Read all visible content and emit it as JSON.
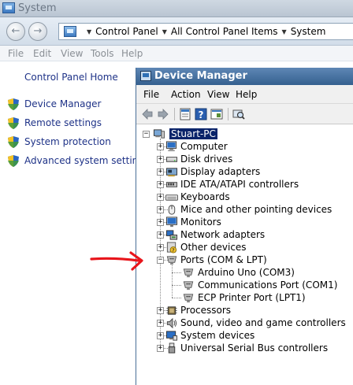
{
  "system_window": {
    "title": "System",
    "breadcrumbs": [
      "Control Panel",
      "All Control Panel Items",
      "System"
    ],
    "menu": [
      "File",
      "Edit",
      "View",
      "Tools",
      "Help"
    ],
    "left_pane": {
      "home_link": "Control Panel Home",
      "tasks": [
        "Device Manager",
        "Remote settings",
        "System protection",
        "Advanced system settings"
      ]
    }
  },
  "device_manager": {
    "title": "Device Manager",
    "menu": [
      "File",
      "Action",
      "View",
      "Help"
    ],
    "toolbar_icons": [
      "back-icon",
      "forward-icon",
      "properties-icon",
      "help-icon",
      "show-hidden-icon",
      "scan-hardware-icon"
    ],
    "root": "Stuart-PC",
    "categories": [
      {
        "label": "Computer",
        "icon": "computer-icon",
        "expanded": false
      },
      {
        "label": "Disk drives",
        "icon": "disk-drive-icon",
        "expanded": false
      },
      {
        "label": "Display adapters",
        "icon": "display-adapter-icon",
        "expanded": false
      },
      {
        "label": "IDE ATA/ATAPI controllers",
        "icon": "ide-controller-icon",
        "expanded": false
      },
      {
        "label": "Keyboards",
        "icon": "keyboard-icon",
        "expanded": false
      },
      {
        "label": "Mice and other pointing devices",
        "icon": "mouse-icon",
        "expanded": false
      },
      {
        "label": "Monitors",
        "icon": "monitor-icon",
        "expanded": false
      },
      {
        "label": "Network adapters",
        "icon": "network-adapter-icon",
        "expanded": false
      },
      {
        "label": "Other devices",
        "icon": "other-devices-icon",
        "expanded": false
      },
      {
        "label": "Ports (COM & LPT)",
        "icon": "port-icon",
        "expanded": true,
        "children": [
          "Arduino Uno (COM3)",
          "Communications Port (COM1)",
          "ECP Printer Port (LPT1)"
        ]
      },
      {
        "label": "Processors",
        "icon": "processor-icon",
        "expanded": false
      },
      {
        "label": "Sound, video and game controllers",
        "icon": "sound-icon",
        "expanded": false
      },
      {
        "label": "System devices",
        "icon": "system-devices-icon",
        "expanded": false
      },
      {
        "label": "Universal Serial Bus controllers",
        "icon": "usb-icon",
        "expanded": false
      }
    ]
  },
  "colors": {
    "link": "#1e3287",
    "selection": "#0a246a",
    "annotation_arrow": "#e8151b",
    "dm_titlebar": "#35608f"
  }
}
